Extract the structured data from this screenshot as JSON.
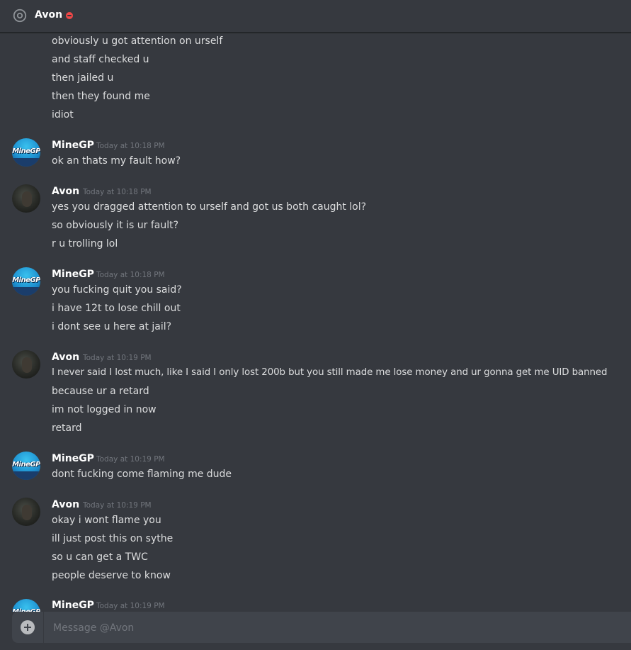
{
  "header": {
    "title": "Avon",
    "icon": "at-sign-icon",
    "status": "do-not-disturb",
    "status_color": "#f04747"
  },
  "groups": [
    {
      "continued": true,
      "lines": [
        "obviously u got attention on urself",
        "and staff checked u",
        "then jailed u",
        "then they found me",
        "idiot"
      ]
    },
    {
      "author": "MineGP",
      "timestamp": "Today at 10:18 PM",
      "avatar": "minegp-logo-avatar",
      "lines": [
        "ok an thats my fault how?"
      ]
    },
    {
      "author": "Avon",
      "timestamp": "Today at 10:18 PM",
      "avatar": "dark-photo-avatar",
      "lines": [
        "yes you dragged attention to urself and got us both caught lol?",
        "so obviously it is ur fault?",
        "r u trolling lol"
      ]
    },
    {
      "author": "MineGP",
      "timestamp": "Today at 10:18 PM",
      "avatar": "minegp-logo-avatar",
      "lines": [
        "you fucking quit you said?",
        "i have 12t to lose chill out",
        "i dont see u here at jail?"
      ]
    },
    {
      "author": "Avon",
      "timestamp": "Today at 10:19 PM",
      "avatar": "dark-photo-avatar",
      "lines": [
        "I never said I lost much, like I said I only lost 200b but you still made me lose money and ur gonna get me UID banned",
        "because ur a retard",
        "im not logged in now",
        "retard"
      ]
    },
    {
      "author": "MineGP",
      "timestamp": "Today at 10:19 PM",
      "avatar": "minegp-logo-avatar",
      "lines": [
        "dont fucking come flaming me dude"
      ]
    },
    {
      "author": "Avon",
      "timestamp": "Today at 10:19 PM",
      "avatar": "dark-photo-avatar",
      "lines": [
        "okay i wont flame you",
        "ill just post this on sythe",
        "so u can get a TWC",
        "people deserve to know"
      ]
    },
    {
      "author": "MineGP",
      "timestamp": "Today at 10:19 PM",
      "avatar": "minegp-logo-avatar",
      "lines": []
    }
  ],
  "avatar_logo_text": "MineGP",
  "composer": {
    "placeholder": "Message @Avon",
    "value": "",
    "attach_icon": "plus-circle-icon"
  }
}
